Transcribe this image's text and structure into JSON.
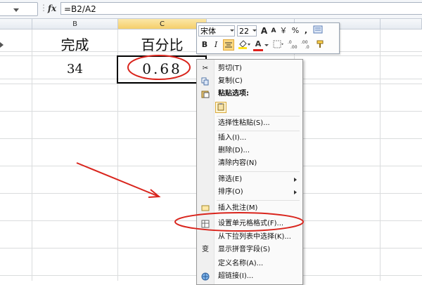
{
  "formula_bar": {
    "fx_label": "fx",
    "formula": "=B2/A2"
  },
  "columns": {
    "b": "B",
    "c": "C"
  },
  "cells": {
    "b1": "完成",
    "c1": "百分比",
    "b2": "34",
    "c2": "0.68"
  },
  "mini_toolbar": {
    "font_name": "宋体",
    "font_size": "22",
    "grow_font": "A",
    "shrink_font": "A",
    "currency": "￥",
    "percent": "%",
    "comma": ",",
    "bold": "B",
    "italic": "I",
    "font_color": "A"
  },
  "context_menu": {
    "items": [
      {
        "label": "剪切(T)"
      },
      {
        "label": "复制(C)"
      },
      {
        "label": "粘贴选项:"
      },
      {
        "label": "选择性粘贴(S)..."
      },
      {
        "label": "插入(I)..."
      },
      {
        "label": "删除(D)..."
      },
      {
        "label": "清除内容(N)"
      },
      {
        "label": "筛选(E)"
      },
      {
        "label": "排序(O)"
      },
      {
        "label": "插入批注(M)"
      },
      {
        "label": "设置单元格格式(F)..."
      },
      {
        "label": "从下拉列表中选择(K)..."
      },
      {
        "label": "显示拼音字段(S)"
      },
      {
        "label": "定义名称(A)..."
      },
      {
        "label": "超链接(I)..."
      }
    ]
  },
  "colors": {
    "annotation_red": "#d9241c",
    "selected_col_header": "#f5cf6a",
    "font_color_swatch": "#e0201b",
    "fill_color_swatch": "#ffe31a"
  }
}
